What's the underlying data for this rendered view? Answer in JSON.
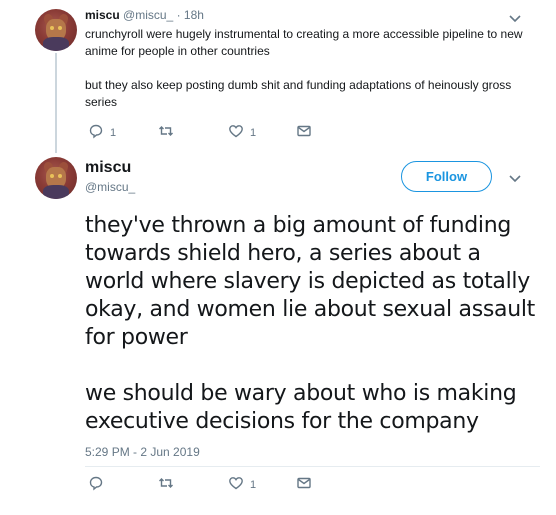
{
  "reply_tweet": {
    "display_name": "miscu",
    "handle": "@miscu_",
    "separator": "·",
    "time": "18h",
    "paragraphs": [
      "crunchyroll were hugely instrumental to creating a more accessible pipeline to new anime for people in other countries",
      "but they also keep posting dumb shit and funding adaptations of heinously gross series"
    ],
    "reply_count": "1",
    "retweet_count": "",
    "like_count": "1"
  },
  "main_tweet": {
    "display_name": "miscu",
    "handle": "@miscu_",
    "follow_label": "Follow",
    "paragraphs": [
      "they've thrown a big amount of funding towards shield hero, a series about a world where slavery is depicted as totally okay, and women lie about sexual assault for power",
      "we should be wary about who is making executive decisions for the company"
    ],
    "timestamp": "5:29 PM - 2 Jun 2019",
    "reply_count": "",
    "retweet_count": "",
    "like_count": "1"
  },
  "colors": {
    "accent": "#1b95e0",
    "muted": "#657786",
    "text": "#14171a",
    "thread_line": "#ccd6dd"
  },
  "icons": [
    "reply-icon",
    "retweet-icon",
    "like-icon",
    "message-icon",
    "chevron-down-icon"
  ]
}
